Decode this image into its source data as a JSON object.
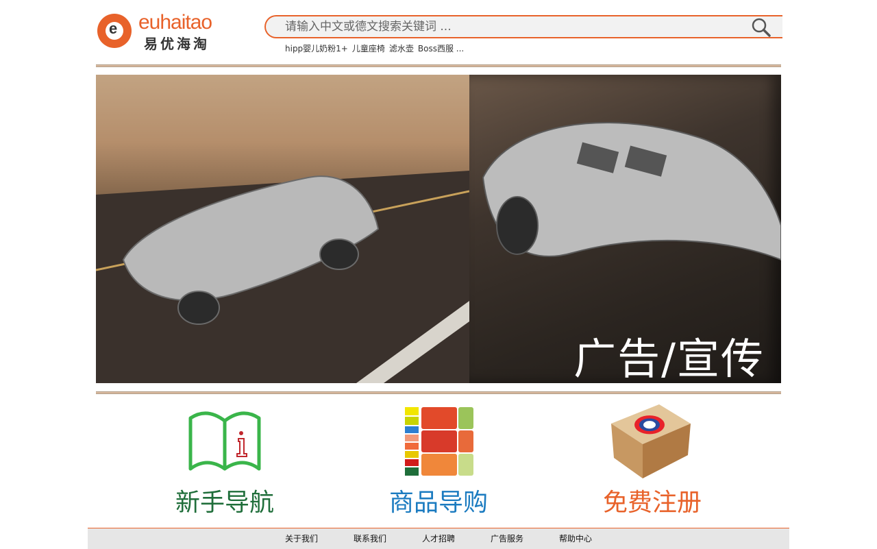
{
  "logo": {
    "brand": "euhaitao",
    "brand_cn": "易优海淘",
    "e": "e"
  },
  "search": {
    "placeholder": "请输入中文或德文搜索关键词 ...",
    "value": ""
  },
  "hot_keywords": [
    "hipp婴儿奶粉1+",
    "儿童座椅",
    "滤水壶",
    "Boss西服 ..."
  ],
  "banner": {
    "text": "广告/宣传"
  },
  "nav_cards": [
    {
      "label": "新手导航",
      "color": "#1f6e3a",
      "icon": "guide-book-icon"
    },
    {
      "label": "商品导购",
      "color": "#1b7bc0",
      "icon": "shopping-guide-icon"
    },
    {
      "label": "免费注册",
      "color": "#e8622a",
      "icon": "register-box-icon"
    }
  ],
  "footer": {
    "links": [
      "关于我们",
      "联系我们",
      "人才招聘",
      "广告服务",
      "帮助中心"
    ]
  },
  "colors": {
    "accent": "#e8622a"
  }
}
